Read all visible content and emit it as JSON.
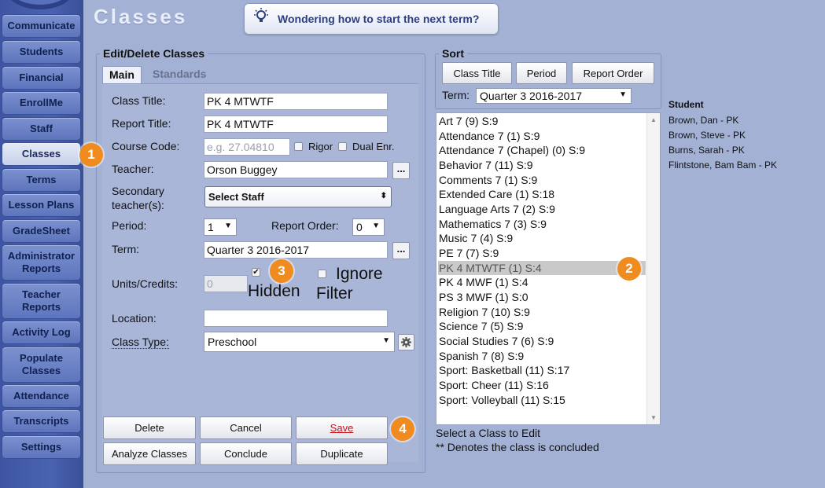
{
  "nav": {
    "items": [
      {
        "label": "Communicate"
      },
      {
        "label": "Students"
      },
      {
        "label": "Financial"
      },
      {
        "label": "EnrollMe"
      },
      {
        "label": "Staff"
      },
      {
        "label": "Classes"
      },
      {
        "label": "Terms"
      },
      {
        "label": "Lesson Plans"
      },
      {
        "label": "GradeSheet"
      },
      {
        "label": "Administrator Reports"
      },
      {
        "label": "Teacher Reports"
      },
      {
        "label": "Activity Log"
      },
      {
        "label": "Populate Classes"
      },
      {
        "label": "Attendance"
      },
      {
        "label": "Transcripts"
      },
      {
        "label": "Settings"
      }
    ]
  },
  "page": {
    "title": "Classes",
    "hint": "Wondering how to start the next term?"
  },
  "edit": {
    "legend": "Edit/Delete Classes",
    "tabs": [
      "Main",
      "Standards"
    ],
    "class_title_label": "Class Title:",
    "class_title_value": "PK 4 MTWTF",
    "report_title_label": "Report Title:",
    "report_title_value": "PK 4 MTWTF",
    "course_code_label": "Course Code:",
    "course_code_placeholder": "e.g. 27.04810",
    "rigor_label": "Rigor",
    "dual_enr_label": "Dual Enr.",
    "teacher_label": "Teacher:",
    "teacher_value": "Orson Buggey",
    "secondary_label_1": "Secondary",
    "secondary_label_2": "teacher(s):",
    "secondary_value": "Select Staff",
    "period_label": "Period:",
    "period_value": "1",
    "report_order_label": "Report Order:",
    "report_order_value": "0",
    "term_label": "Term:",
    "term_value": "Quarter 3 2016-2017",
    "units_label": "Units/Credits:",
    "units_placeholder": "0",
    "hidden_label": "Hidden",
    "hidden_checked": "✔",
    "ignore_label_1": "Ignore",
    "ignore_label_2": "Filter",
    "location_label": "Location:",
    "location_value": "",
    "class_type_label": "Class Type:",
    "class_type_value": "Preschool",
    "buttons": {
      "delete": "Delete",
      "cancel": "Cancel",
      "save": "Save",
      "analyze": "Analyze Classes",
      "conclude": "Conclude",
      "duplicate": "Duplicate"
    }
  },
  "sort": {
    "legend": "Sort",
    "buttons": [
      "Class Title",
      "Period",
      "Report Order"
    ],
    "term_label": "Term:",
    "term_value": "Quarter 3 2016-2017"
  },
  "classes": [
    "Art 7 (9) S:9",
    "Attendance 7 (1) S:9",
    "Attendance 7 (Chapel) (0) S:9",
    "Behavior 7 (11) S:9",
    "Comments 7 (1) S:9",
    "Extended Care (1) S:18",
    "Language Arts 7 (2) S:9",
    "Mathematics 7 (3) S:9",
    "Music 7 (4) S:9",
    "PE 7 (7) S:9",
    "PK 4 MTWTF (1) S:4",
    "PK 4 MWF (1) S:4",
    "PS 3 MWF (1) S:0",
    "Religion 7 (10) S:9",
    "Science 7 (5) S:9",
    "Social Studies 7 (6) S:9",
    "Spanish 7 (8) S:9",
    "Sport: Basketball (11) S:17",
    "Sport: Cheer (11) S:16",
    "Sport: Volleyball (11) S:15"
  ],
  "selected_class": "PK 4 MTWTF (1) S:4",
  "notes": {
    "select": "Select a Class to Edit",
    "concluded": "** Denotes the class is concluded"
  },
  "students": {
    "header": "Student",
    "list": [
      "Brown, Dan - PK",
      "Brown, Steve - PK",
      "Burns, Sarah - PK",
      "Flintstone, Bam Bam - PK"
    ]
  },
  "callouts": [
    "1",
    "2",
    "3",
    "4"
  ],
  "colors": {
    "background": "#a3b1d4",
    "sidebar": "#4a63b1",
    "callout": "#f08b1f",
    "save_text": "#c4121a",
    "selected_row": "#c9c9c9"
  }
}
